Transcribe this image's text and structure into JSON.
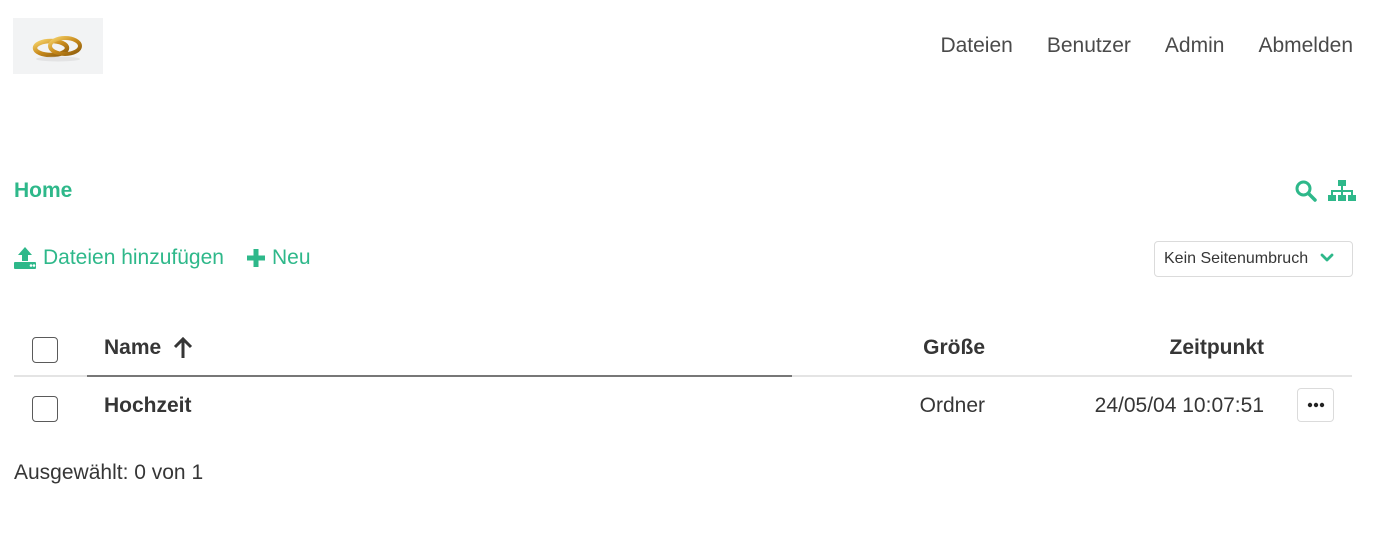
{
  "nav": {
    "items": [
      {
        "label": "Dateien"
      },
      {
        "label": "Benutzer"
      },
      {
        "label": "Admin"
      },
      {
        "label": "Abmelden"
      }
    ]
  },
  "breadcrumb": {
    "home": "Home"
  },
  "actions": {
    "upload_label": "Dateien hinzufügen",
    "new_label": "Neu"
  },
  "pagination_select": {
    "value": "Kein Seitenumbruch"
  },
  "table": {
    "columns": {
      "name": "Name",
      "size": "Größe",
      "time": "Zeitpunkt"
    },
    "sort": {
      "column": "Name",
      "direction": "ascending"
    },
    "rows": [
      {
        "name": "Hochzeit",
        "size": "Ordner",
        "time": "24/05/04 10:07:51"
      }
    ]
  },
  "footer": {
    "selection_text": "Ausgewählt: 0 von 1"
  },
  "colors": {
    "accent": "#2eb88a",
    "text": "#363636",
    "nav_text": "#4a4a4a"
  },
  "icons": [
    "wedding-rings-logo",
    "search-icon",
    "sitemap-icon",
    "upload-icon",
    "plus-icon",
    "chevron-down-icon",
    "arrow-up-icon",
    "ellipsis-icon"
  ]
}
